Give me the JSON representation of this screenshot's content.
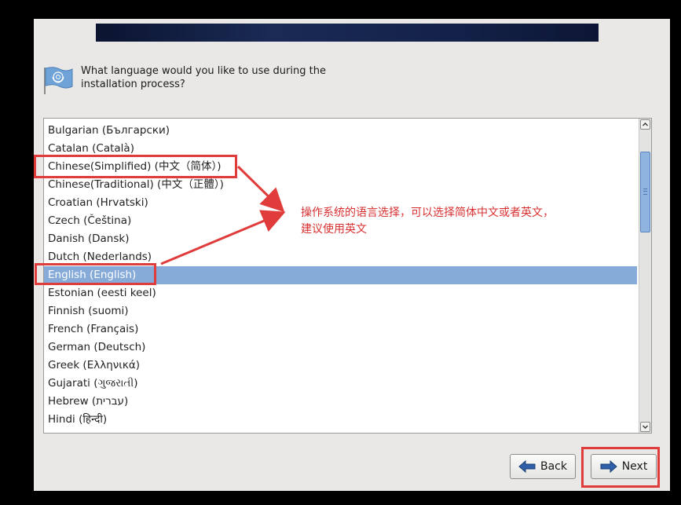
{
  "prompt": {
    "line1": "What language would you like to use during the",
    "line2": "installation process?"
  },
  "languages": [
    "Bulgarian (Български)",
    "Catalan (Català)",
    "Chinese(Simplified) (中文（简体）)",
    "Chinese(Traditional) (中文（正體）)",
    "Croatian (Hrvatski)",
    "Czech (Čeština)",
    "Danish (Dansk)",
    "Dutch (Nederlands)",
    "English (English)",
    "Estonian (eesti keel)",
    "Finnish (suomi)",
    "French (Français)",
    "German (Deutsch)",
    "Greek (Ελληνικά)",
    "Gujarati (ગુજરાતી)",
    "Hebrew (עברית)",
    "Hindi (हिन्दी)"
  ],
  "selected_language": "English (English)",
  "buttons": {
    "back_label": "Back",
    "next_label": "Next"
  },
  "annotation": {
    "line1": "操作系统的语言选择，可以选择简体中文或者英文，",
    "line2": "建议使用英文"
  },
  "icons": {
    "flag": "un-flag-icon",
    "back": "left-arrow-icon",
    "next": "right-arrow-icon"
  },
  "colors": {
    "selection": "#86abd9",
    "annotation": "#e03c3c",
    "arrow_icon": "#2f5fa8"
  }
}
